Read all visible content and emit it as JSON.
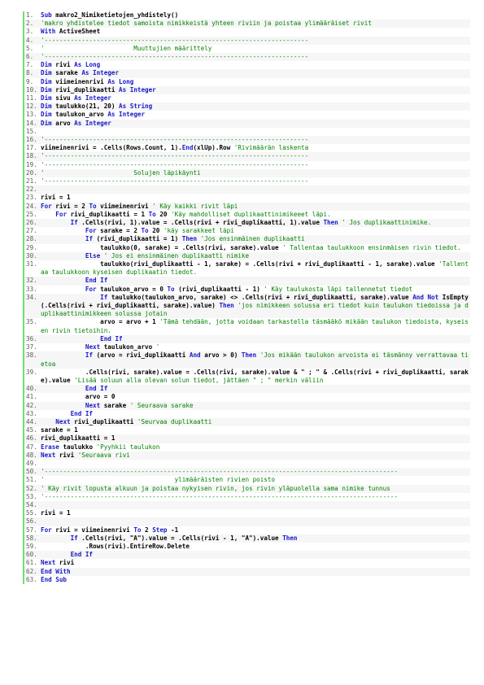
{
  "colors": {
    "keyword": "#1717c8",
    "comment": "#008200",
    "gutter": "#6ce26c",
    "alt_row": "#f6f6f6"
  },
  "lines": [
    {
      "n": "1.",
      "spans": [
        {
          "t": "kw",
          "v": "Sub "
        },
        {
          "t": "bd",
          "v": "makro2_Nimiketietojen_yhdistely()"
        }
      ]
    },
    {
      "n": "2.",
      "spans": [
        {
          "t": "cm",
          "v": "'makro yhdistelee tiedot samoista nimikkeistä yhteen riviin ja poistaa ylimääräiset rivit"
        }
      ]
    },
    {
      "n": "3.",
      "spans": [
        {
          "t": "kw",
          "v": "With "
        },
        {
          "t": "bd",
          "v": "ActiveSheet"
        }
      ]
    },
    {
      "n": "4.",
      "spans": [
        {
          "t": "cm",
          "v": "'-----------------------------------------------------------------------"
        }
      ]
    },
    {
      "n": "5.",
      "spans": [
        {
          "t": "cm",
          "v": "'                        Muuttujien määrittely"
        }
      ]
    },
    {
      "n": "6.",
      "spans": [
        {
          "t": "cm",
          "v": "'-----------------------------------------------------------------------"
        }
      ]
    },
    {
      "n": "7.",
      "spans": [
        {
          "t": "kw",
          "v": "Dim "
        },
        {
          "t": "bd",
          "v": "rivi "
        },
        {
          "t": "kw",
          "v": "As Long"
        }
      ]
    },
    {
      "n": "8.",
      "spans": [
        {
          "t": "kw",
          "v": "Dim "
        },
        {
          "t": "bd",
          "v": "sarake "
        },
        {
          "t": "kw",
          "v": "As Integer"
        }
      ]
    },
    {
      "n": "9.",
      "spans": [
        {
          "t": "kw",
          "v": "Dim "
        },
        {
          "t": "bd",
          "v": "viimeinenrivi "
        },
        {
          "t": "kw",
          "v": "As Long"
        }
      ]
    },
    {
      "n": "10.",
      "spans": [
        {
          "t": "kw",
          "v": "Dim "
        },
        {
          "t": "bd",
          "v": "rivi_duplikaatti "
        },
        {
          "t": "kw",
          "v": "As Integer"
        }
      ]
    },
    {
      "n": "11.",
      "spans": [
        {
          "t": "kw",
          "v": "Dim "
        },
        {
          "t": "bd",
          "v": "sivu "
        },
        {
          "t": "kw",
          "v": "As Integer"
        }
      ]
    },
    {
      "n": "12.",
      "spans": [
        {
          "t": "kw",
          "v": "Dim "
        },
        {
          "t": "bd",
          "v": "taulukko(21, 20) "
        },
        {
          "t": "kw",
          "v": "As String"
        }
      ]
    },
    {
      "n": "13.",
      "spans": [
        {
          "t": "kw",
          "v": "Dim "
        },
        {
          "t": "bd",
          "v": "taulukon_arvo "
        },
        {
          "t": "kw",
          "v": "As Integer"
        }
      ]
    },
    {
      "n": "14.",
      "spans": [
        {
          "t": "kw",
          "v": "Dim "
        },
        {
          "t": "bd",
          "v": "arvo "
        },
        {
          "t": "kw",
          "v": "As Integer"
        }
      ]
    },
    {
      "n": "15.",
      "spans": []
    },
    {
      "n": "16.",
      "spans": [
        {
          "t": "cm",
          "v": "'-----------------------------------------------------------------------"
        }
      ]
    },
    {
      "n": "17.",
      "spans": [
        {
          "t": "bd",
          "v": "viimeinenrivi = .Cells(Rows.Count, 1)."
        },
        {
          "t": "kw",
          "v": "End"
        },
        {
          "t": "bd",
          "v": "(xlUp).Row "
        },
        {
          "t": "cm",
          "v": "'Rivimäärän laskenta"
        }
      ]
    },
    {
      "n": "18.",
      "spans": [
        {
          "t": "cm",
          "v": "'-----------------------------------------------------------------------"
        }
      ]
    },
    {
      "n": "19.",
      "spans": [
        {
          "t": "cm",
          "v": "'-----------------------------------------------------------------------"
        }
      ]
    },
    {
      "n": "20.",
      "spans": [
        {
          "t": "cm",
          "v": "'                        Solujen läpikäynti"
        }
      ]
    },
    {
      "n": "21.",
      "spans": [
        {
          "t": "cm",
          "v": "'-----------------------------------------------------------------------"
        }
      ]
    },
    {
      "n": "22.",
      "spans": []
    },
    {
      "n": "23.",
      "spans": [
        {
          "t": "bd",
          "v": "rivi = 1"
        }
      ]
    },
    {
      "n": "24.",
      "spans": [
        {
          "t": "kw",
          "v": "For "
        },
        {
          "t": "bd",
          "v": "rivi = 2 "
        },
        {
          "t": "kw",
          "v": "To "
        },
        {
          "t": "bd",
          "v": "viimeinenrivi "
        },
        {
          "t": "cm",
          "v": "' Käy kaikki rivit läpi"
        }
      ]
    },
    {
      "n": "25.",
      "spans": [
        {
          "t": "kw",
          "v": "    For "
        },
        {
          "t": "bd",
          "v": "rivi_duplikaatti = 1 "
        },
        {
          "t": "kw",
          "v": "To "
        },
        {
          "t": "bd",
          "v": "20 "
        },
        {
          "t": "cm",
          "v": "'Käy mahdolliset duplikaattinimikeeet läpi."
        }
      ]
    },
    {
      "n": "26.",
      "spans": [
        {
          "t": "kw",
          "v": "        If "
        },
        {
          "t": "bd",
          "v": ".Cells(rivi, 1).value = .Cells(rivi + rivi_duplikaatti, 1).value "
        },
        {
          "t": "kw",
          "v": "Then "
        },
        {
          "t": "cm",
          "v": "' Jos duplikaattinimike."
        }
      ]
    },
    {
      "n": "27.",
      "spans": [
        {
          "t": "kw",
          "v": "            For "
        },
        {
          "t": "bd",
          "v": "sarake = 2 "
        },
        {
          "t": "kw",
          "v": "To "
        },
        {
          "t": "bd",
          "v": "20 "
        },
        {
          "t": "cm",
          "v": "'käy sarakkeet läpi"
        }
      ]
    },
    {
      "n": "28.",
      "spans": [
        {
          "t": "kw",
          "v": "            If "
        },
        {
          "t": "bd",
          "v": "(rivi_duplikaatti = 1) "
        },
        {
          "t": "kw",
          "v": "Then "
        },
        {
          "t": "cm",
          "v": "'Jos ensinmäinen duplikaatti"
        }
      ]
    },
    {
      "n": "29.",
      "spans": [
        {
          "t": "bd",
          "v": "                taulukko(0, sarake) = .Cells(rivi, sarake).value "
        },
        {
          "t": "cm",
          "v": "' Tallentaa taulukkoon ensinmäisen rivin tiedot."
        }
      ]
    },
    {
      "n": "30.",
      "spans": [
        {
          "t": "kw",
          "v": "            Else "
        },
        {
          "t": "cm",
          "v": "' Jos ei ensinmäinen duplikaatti nimike"
        }
      ]
    },
    {
      "n": "31.",
      "spans": [
        {
          "t": "bd",
          "v": "                taulukko(rivi_duplikaatti - 1, sarake) = .Cells(rivi + rivi_duplikaatti - 1, sarake).value "
        },
        {
          "t": "cm",
          "v": "'Tallentaa taulukkoon kyseisen duplikaatin tiedot."
        }
      ]
    },
    {
      "n": "32.",
      "spans": [
        {
          "t": "kw",
          "v": "            End If"
        }
      ]
    },
    {
      "n": "33.",
      "spans": [
        {
          "t": "kw",
          "v": "            For "
        },
        {
          "t": "bd",
          "v": "taulukon_arvo = 0 "
        },
        {
          "t": "kw",
          "v": "To "
        },
        {
          "t": "bd",
          "v": "(rivi_duplikaatti - 1) "
        },
        {
          "t": "cm",
          "v": "' Käy taulukosta läpi tallennetut tiedot"
        }
      ]
    },
    {
      "n": "34.",
      "spans": [
        {
          "t": "kw",
          "v": "                If "
        },
        {
          "t": "bd",
          "v": "taulukko(taulukon_arvo, sarake) <> .Cells(rivi + rivi_duplikaatti, sarake).value "
        },
        {
          "t": "kw",
          "v": "And Not "
        },
        {
          "t": "bd",
          "v": "IsEmpty(.Cells(rivi + rivi_duplikaatti, sarake).value) "
        },
        {
          "t": "kw",
          "v": "Then "
        },
        {
          "t": "cm",
          "v": "'jos nimikkeen solussa eri tiedot kuin taulukon tiedoissa ja duplikaattinimikkeen solussa jotain"
        }
      ]
    },
    {
      "n": "35.",
      "spans": [
        {
          "t": "bd",
          "v": "                arvo = arvo + 1 "
        },
        {
          "t": "cm",
          "v": "'Tämä tehdään, jotta voidaan tarkastella täsmääkö mikään taulukon tiedoista, kyseisen rivin tietoihin."
        }
      ]
    },
    {
      "n": "36.",
      "spans": [
        {
          "t": "kw",
          "v": "                End If"
        }
      ]
    },
    {
      "n": "37.",
      "spans": [
        {
          "t": "kw",
          "v": "            Next "
        },
        {
          "t": "bd",
          "v": "taulukon_arvo "
        },
        {
          "t": "cm",
          "v": "'"
        }
      ]
    },
    {
      "n": "38.",
      "spans": [
        {
          "t": "kw",
          "v": "            If "
        },
        {
          "t": "bd",
          "v": "(arvo = rivi_duplikaatti "
        },
        {
          "t": "kw",
          "v": "And "
        },
        {
          "t": "bd",
          "v": "arvo > 0) "
        },
        {
          "t": "kw",
          "v": "Then "
        },
        {
          "t": "cm",
          "v": "'Jos mikään taulukon arvoista ei täsmänny verrattavaa tietoa"
        }
      ]
    },
    {
      "n": "39.",
      "spans": [
        {
          "t": "bd",
          "v": "            .Cells(rivi, sarake).value = .Cells(rivi, sarake).value & \" ; \" & .Cells(rivi + rivi_duplikaatti, sarake).value "
        },
        {
          "t": "cm",
          "v": "'Lisää soluun alla olevan solun tiedot, jättäen \" ; \" merkin väliin"
        }
      ]
    },
    {
      "n": "40.",
      "spans": [
        {
          "t": "kw",
          "v": "            End If"
        }
      ]
    },
    {
      "n": "41.",
      "spans": [
        {
          "t": "bd",
          "v": "            arvo = 0"
        }
      ]
    },
    {
      "n": "42.",
      "spans": [
        {
          "t": "kw",
          "v": "            Next "
        },
        {
          "t": "bd",
          "v": "sarake "
        },
        {
          "t": "cm",
          "v": "' Seuraava sarake"
        }
      ]
    },
    {
      "n": "43.",
      "spans": [
        {
          "t": "kw",
          "v": "        End If"
        }
      ]
    },
    {
      "n": "44.",
      "spans": [
        {
          "t": "kw",
          "v": "    Next "
        },
        {
          "t": "bd",
          "v": "rivi_duplikaatti "
        },
        {
          "t": "cm",
          "v": "'Seurvaa duplikaatti"
        }
      ]
    },
    {
      "n": "45.",
      "spans": [
        {
          "t": "bd",
          "v": "sarake = 1"
        }
      ]
    },
    {
      "n": "46.",
      "spans": [
        {
          "t": "bd",
          "v": "rivi_duplikaatti = 1"
        }
      ]
    },
    {
      "n": "47.",
      "spans": [
        {
          "t": "kw",
          "v": "Erase "
        },
        {
          "t": "bd",
          "v": "taulukko "
        },
        {
          "t": "cm",
          "v": "'Pyyhkii taulukon"
        }
      ]
    },
    {
      "n": "48.",
      "spans": [
        {
          "t": "kw",
          "v": "Next "
        },
        {
          "t": "bd",
          "v": "rivi "
        },
        {
          "t": "cm",
          "v": "'Seuraava rivi"
        }
      ]
    },
    {
      "n": "49.",
      "spans": []
    },
    {
      "n": "50.",
      "spans": [
        {
          "t": "cm",
          "v": "'-----------------------------------------------------------------------------------------------"
        }
      ]
    },
    {
      "n": "51.",
      "spans": [
        {
          "t": "cm",
          "v": "'                                   ylimääräisten rivien poisto"
        }
      ]
    },
    {
      "n": "52.",
      "spans": [
        {
          "t": "cm",
          "v": "' Käy rivit lopusta alkuun ja poistaa nykyisen rivin, jos rivin yläpuolella sama nimike tunnus"
        }
      ]
    },
    {
      "n": "53.",
      "spans": [
        {
          "t": "cm",
          "v": "'-----------------------------------------------------------------------------------------------"
        }
      ]
    },
    {
      "n": "54.",
      "spans": []
    },
    {
      "n": "55.",
      "spans": [
        {
          "t": "bd",
          "v": "rivi = 1"
        }
      ]
    },
    {
      "n": "56.",
      "spans": []
    },
    {
      "n": "57.",
      "spans": [
        {
          "t": "kw",
          "v": "For "
        },
        {
          "t": "bd",
          "v": "rivi = viimeinenrivi "
        },
        {
          "t": "kw",
          "v": "To "
        },
        {
          "t": "bd",
          "v": "2 "
        },
        {
          "t": "kw",
          "v": "Step "
        },
        {
          "t": "bd",
          "v": "-1"
        }
      ]
    },
    {
      "n": "58.",
      "spans": [
        {
          "t": "kw",
          "v": "        If "
        },
        {
          "t": "bd",
          "v": ".Cells(rivi, \"A\").value = .Cells(rivi - 1, \"A\").value "
        },
        {
          "t": "kw",
          "v": "Then"
        }
      ]
    },
    {
      "n": "59.",
      "spans": [
        {
          "t": "bd",
          "v": "            .Rows(rivi).EntireRow.Delete"
        }
      ]
    },
    {
      "n": "60.",
      "spans": [
        {
          "t": "kw",
          "v": "        End If"
        }
      ]
    },
    {
      "n": "61.",
      "spans": [
        {
          "t": "kw",
          "v": "Next "
        },
        {
          "t": "bd",
          "v": "rivi"
        }
      ]
    },
    {
      "n": "62.",
      "spans": [
        {
          "t": "kw",
          "v": "End With"
        }
      ]
    },
    {
      "n": "63.",
      "spans": [
        {
          "t": "kw",
          "v": "End Sub"
        }
      ]
    }
  ]
}
